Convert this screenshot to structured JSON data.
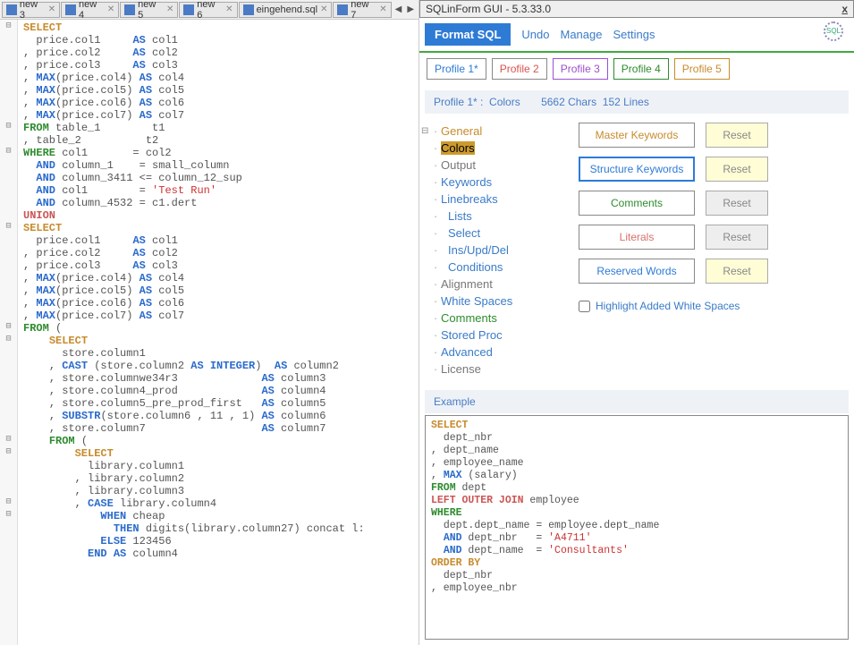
{
  "window_title": "SQLinForm GUI - 5.3.33.0",
  "file_tabs": [
    "new 3",
    "new 4",
    "new 5",
    "new 6",
    "eingehend.sql",
    "new 7"
  ],
  "toolbar": {
    "format": "Format SQL",
    "undo": "Undo",
    "manage": "Manage",
    "settings": "Settings"
  },
  "profiles": [
    "Profile 1*",
    "Profile 2",
    "Profile 3",
    "Profile 4",
    "Profile 5"
  ],
  "status": {
    "profile": "Profile 1* :",
    "section": "Colors",
    "chars": "5662  Chars",
    "lines": "152  Lines"
  },
  "tree": {
    "general": "General",
    "colors": "Colors",
    "output": "Output",
    "keywords": "Keywords",
    "linebreaks": "Linebreaks",
    "lists": "Lists",
    "select": "Select",
    "iud": "Ins/Upd/Del",
    "conditions": "Conditions",
    "alignment": "Alignment",
    "whitespaces": "White Spaces",
    "comments": "Comments",
    "storedproc": "Stored Proc",
    "advanced": "Advanced",
    "license": "License"
  },
  "color_buttons": {
    "master": "Master Keywords",
    "structure": "Structure Keywords",
    "comments": "Comments",
    "literals": "Literals",
    "reserved": "Reserved Words",
    "reset": "Reset"
  },
  "checkbox": "Highlight Added White Spaces",
  "example_label": "Example",
  "code": {
    "l1": "SELECT",
    "l2": "  price.col1     AS col1",
    "l3": ", price.col2     AS col2",
    "l4": ", price.col3     AS col3",
    "l5": ", MAX(price.col4) AS col4",
    "l6": ", MAX(price.col5) AS col5",
    "l7": ", MAX(price.col6) AS col6",
    "l8": ", MAX(price.col7) AS col7",
    "l9": "FROM table_1        t1",
    "l10": ", table_2          t2",
    "l11": "WHERE col1       = col2",
    "l12": "  AND column_1    = small_column",
    "l13": "  AND column_3411 <= column_12_sup",
    "l14": "  AND col1        = 'Test Run'",
    "l15": "  AND column_4532 = c1.dert",
    "l16": "UNION",
    "l17": "SELECT",
    "l18": "  price.col1     AS col1",
    "l19": ", price.col2     AS col2",
    "l20": ", price.col3     AS col3",
    "l21": ", MAX(price.col4) AS col4",
    "l22": ", MAX(price.col5) AS col5",
    "l23": ", MAX(price.col6) AS col6",
    "l24": ", MAX(price.col7) AS col7",
    "l25": "FROM (",
    "l26": "    SELECT",
    "l27": "      store.column1",
    "l28": "    , CAST (store.column2 AS INTEGER)  AS column2",
    "l29": "    , store.columnwe34r3             AS column3",
    "l30": "    , store.column4_prod             AS column4",
    "l31": "    , store.column5_pre_prod_first   AS column5",
    "l32": "    , SUBSTR(store.column6 , 11 , 1) AS column6",
    "l33": "    , store.column7                  AS column7",
    "l34": "    FROM (",
    "l35": "        SELECT",
    "l36": "          library.column1",
    "l37": "        , library.column2",
    "l38": "        , library.column3",
    "l39": "        , CASE library.column4",
    "l40": "            WHEN cheap",
    "l41": "              THEN digits(library.column27) concat l:",
    "l42": "            ELSE 123456",
    "l43": "          END AS column4"
  },
  "example_code": {
    "e1": "SELECT",
    "e2": "  dept_nbr",
    "e3": ", dept_name",
    "e4": ", employee_name",
    "e5": ", MAX (salary)",
    "e6": "FROM dept",
    "e7": "LEFT OUTER JOIN employee",
    "e8": "WHERE",
    "e9": "  dept.dept_name = employee.dept_name",
    "e10": "  AND dept_nbr   = 'A4711'",
    "e11": "  AND dept_name  = 'Consultants'",
    "e12": "ORDER BY",
    "e13": "  dept_nbr",
    "e14": ", employee_nbr"
  }
}
